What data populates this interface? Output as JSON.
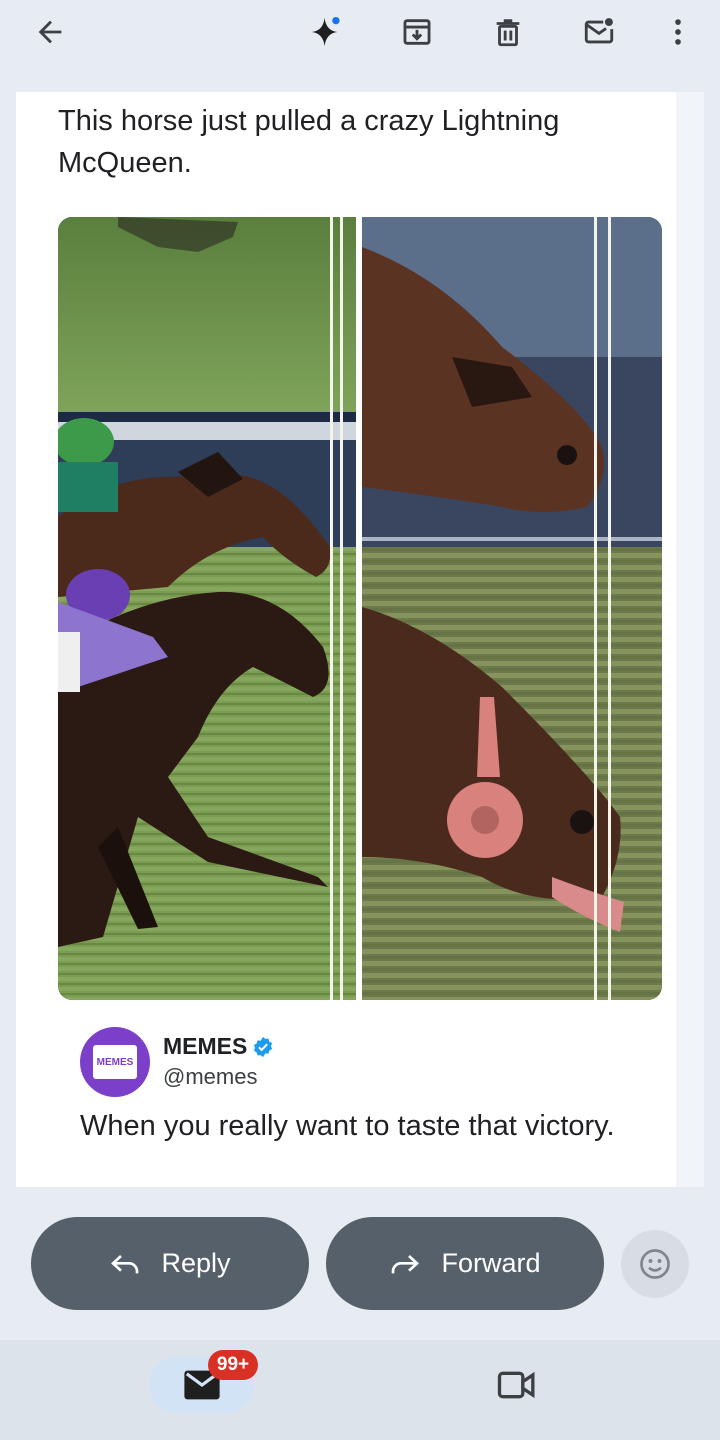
{
  "toolbar": {
    "icons": [
      "back-arrow-icon",
      "gemini-sparkle-icon",
      "archive-icon",
      "delete-icon",
      "mark-unread-icon",
      "more-vert-icon"
    ]
  },
  "email": {
    "tweet_text": "This horse just pulled a crazy Lightning McQueen.",
    "image_description": "photo-finish-horse-race",
    "quoted": {
      "avatar_label": "MEMES",
      "name": "MEMES",
      "handle": "@memes",
      "text": "When you really want to taste that victory."
    }
  },
  "actions": {
    "reply_label": "Reply",
    "forward_label": "Forward"
  },
  "bottom_nav": {
    "mail_badge": "99+"
  },
  "colors": {
    "accent": "#1a73e8",
    "button_bg": "#55606a",
    "badge_bg": "#d93025",
    "avatar_bg": "#7b3fc9"
  }
}
